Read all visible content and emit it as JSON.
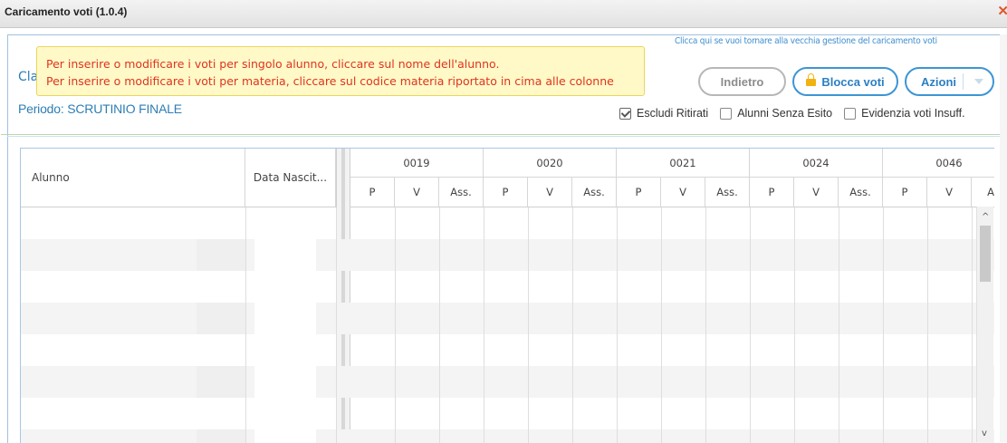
{
  "window": {
    "title": "Caricamento voti (1.0.4)",
    "close_icon": "close-icon"
  },
  "header": {
    "old_management_link": "Clicca qui se vuoi tornare alla vecchia gestione del caricamento voti",
    "class_label_partial": "Cla",
    "period_label": "Periodo: SCRUTINIO FINALE",
    "tooltip_line1": "Per inserire o modificare i voti per singolo alunno, cliccare sul nome dell'alunno.",
    "tooltip_line2": "Per inserire o modificare i voti per materia, cliccare sul codice materia riportato in cima alle colonne"
  },
  "toolbar": {
    "back_label": "Indietro",
    "lock_label": "Blocca voti",
    "actions_label": "Azioni"
  },
  "filters": [
    {
      "label": "Escludi Ritirati",
      "checked": true
    },
    {
      "label": "Alunni Senza Esito",
      "checked": false
    },
    {
      "label": "Evidenzia voti Insuff.",
      "checked": false
    }
  ],
  "grid": {
    "col_student": "Alunno",
    "col_birth": "Data Nascit...",
    "subjects": [
      "0019",
      "0020",
      "0021",
      "0024",
      "0046"
    ],
    "subcols": [
      "P",
      "V",
      "Ass."
    ],
    "last_subcol_partial": "As"
  },
  "colors": {
    "accent": "#3c95d3",
    "period_text": "#2d7eb5",
    "tooltip_bg": "#fff9c8",
    "tooltip_text": "#e0341e",
    "lock_icon": "#f2b20f"
  }
}
